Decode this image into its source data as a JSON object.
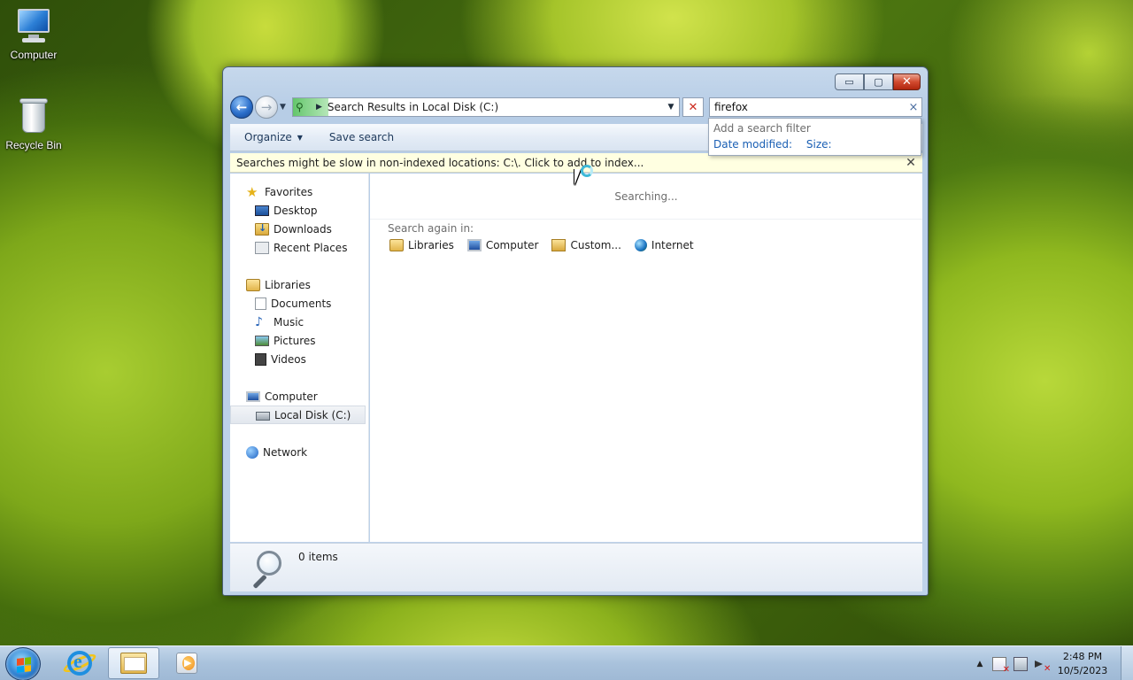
{
  "desktop": {
    "icons": [
      {
        "label": "Computer",
        "icon": "computer-icon"
      },
      {
        "label": "Recycle Bin",
        "icon": "recycle-bin-icon"
      }
    ]
  },
  "window": {
    "caption": {
      "minimize": "▭",
      "maximize": "▢",
      "close": "✕"
    },
    "address": {
      "text": "Search Results in Local Disk (C:)"
    },
    "search": {
      "value": "firefox",
      "clear": "×"
    },
    "filter_popup": {
      "hint": "Add a search filter",
      "filters": [
        "Date modified:",
        "Size:"
      ]
    },
    "toolbar": {
      "organize": "Organize",
      "save_search": "Save search"
    },
    "infobar": {
      "text": "Searches might be slow in non-indexed locations: C:\\. Click to add to index...",
      "close": "✕"
    },
    "nav": {
      "favorites": {
        "label": "Favorites",
        "items": [
          "Desktop",
          "Downloads",
          "Recent Places"
        ]
      },
      "libraries": {
        "label": "Libraries",
        "items": [
          "Documents",
          "Music",
          "Pictures",
          "Videos"
        ]
      },
      "computer": {
        "label": "Computer",
        "items": [
          "Local Disk (C:)"
        ]
      },
      "network": {
        "label": "Network"
      }
    },
    "content": {
      "status": "Searching...",
      "search_again_label": "Search again in:",
      "search_again": [
        "Libraries",
        "Computer",
        "Custom...",
        "Internet"
      ]
    },
    "details": {
      "count": "0 items"
    }
  },
  "taskbar": {
    "pinned": [
      "start-button",
      "internet-explorer",
      "windows-explorer",
      "windows-media-player"
    ],
    "active": "windows-explorer",
    "clock": {
      "time": "2:48 PM",
      "date": "10/5/2023"
    },
    "tray_chevron": "▲"
  },
  "colors": {
    "accent": "#1a5fb4",
    "infobar": "#ffffe1",
    "close_button": "#d24a2f"
  }
}
